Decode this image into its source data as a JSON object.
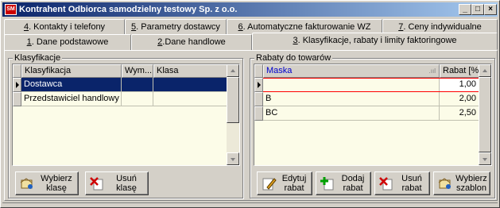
{
  "window": {
    "title": "Kontrahent Odbiorca samodzielny testowy Sp. z o.o.",
    "app_icon": "SM"
  },
  "title_buttons": {
    "minimize": "_",
    "maximize": "□",
    "close": "×"
  },
  "tabs_row1": [
    {
      "key": "4",
      "rest": ". Kontakty i telefony"
    },
    {
      "key": "5",
      "rest": ". Parametry dostawcy"
    },
    {
      "key": "6",
      "rest": ". Automatyczne fakturowanie WZ"
    },
    {
      "key": "7",
      "rest": ". Ceny indywidualne"
    }
  ],
  "tabs_row2": [
    {
      "key": "1",
      "rest": ". Dane podstawowe"
    },
    {
      "key": "2",
      "rest": ".Dane handlowe"
    },
    {
      "key": "3",
      "rest": ". Klasyfikacje, rabaty i limity faktoringowe"
    }
  ],
  "klasyfikacje": {
    "legend": "Klasyfikacje",
    "columns": [
      "Klasyfikacja",
      "Wym...",
      "Klasa"
    ],
    "rows": [
      {
        "klasyfikacja": "Dostawca",
        "wym": "",
        "klasa": ""
      },
      {
        "klasyfikacja": "Przedstawiciel handlowy",
        "wym": "",
        "klasa": ""
      }
    ],
    "buttons": {
      "choose": "Wybierz\nklasę",
      "delete": "Usuń\nklasę"
    }
  },
  "rabaty": {
    "legend": "Rabaty do towarów",
    "columns": [
      "Maska",
      "Rabat [%]"
    ],
    "rows": [
      {
        "maska": "",
        "rabat": "1,00"
      },
      {
        "maska": "B",
        "rabat": "2,00"
      },
      {
        "maska": "BC",
        "rabat": "2,50"
      }
    ],
    "buttons": {
      "edit": "Edytuj\nrabat",
      "add": "Dodaj\nrabat",
      "delete": "Usuń\nrabat",
      "template": "Wybierz\nszablon"
    }
  },
  "colors": {
    "selection": "#0a246a",
    "grid_bg": "#fcfce8",
    "header_link": "#0000cc",
    "edit_row_border": "#ff0000"
  }
}
